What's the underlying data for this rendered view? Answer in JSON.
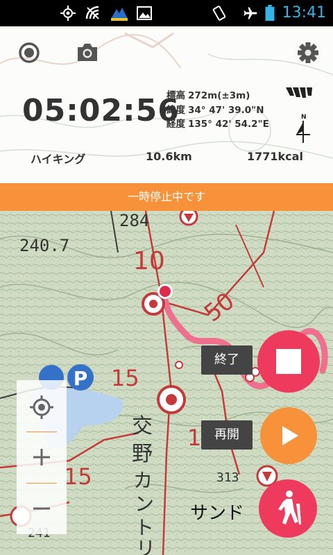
{
  "status_bar": {
    "time": "13:41",
    "icons": [
      "gps-icon",
      "no-signal-icon",
      "app-icon",
      "image-icon",
      "rotate-icon",
      "airplane-mode-icon",
      "battery-icon"
    ]
  },
  "header": {
    "timer": "05:02:56",
    "altitude_label": "標高",
    "altitude_value": "272m(±3m)",
    "latitude_label": "緯度",
    "latitude_value": "34° 47' 39.0\"N",
    "longitude_label": "経度",
    "longitude_value": "135° 42' 54.2\"E",
    "compass_label": "N",
    "activity": "ハイキング",
    "distance": "10.6km",
    "calories": "1771kcal"
  },
  "banner": {
    "text": "一時停止中です"
  },
  "map": {
    "labels": [
      "284",
      "240.7",
      "10",
      "50",
      "15",
      "15",
      "1",
      "交",
      "野",
      "カ",
      "ン",
      "ト",
      "リ",
      "サンド",
      "313",
      "241",
      "P"
    ]
  },
  "actions": {
    "end_label": "終了",
    "resume_label": "再開"
  },
  "colors": {
    "accent_orange": "#f7923a",
    "record_red": "#ee3a5c",
    "tooltip_dark": "#444444",
    "status_time_blue": "#33b5e5"
  }
}
